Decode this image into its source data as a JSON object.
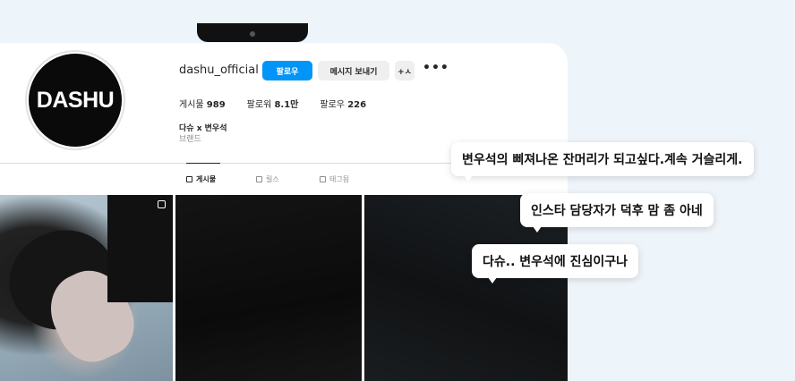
{
  "profile": {
    "avatar_text": "DASHU",
    "username": "dashu_official",
    "follow_label": "팔로우",
    "message_label": "메시지 보내기",
    "add_user_icon": "+ㅅ",
    "more_icon": "•••",
    "stats": {
      "posts_label": "게시물",
      "posts_value": "989",
      "followers_label": "팔로워",
      "followers_value": "8.1만",
      "following_label": "팔로우",
      "following_value": "226"
    },
    "full_name": "다슈 x 변우석",
    "category": "브랜드"
  },
  "tabs": [
    {
      "label": "게시물",
      "icon": "grid-icon",
      "active": true
    },
    {
      "label": "릴스",
      "icon": "reels-icon",
      "active": false
    },
    {
      "label": "태그됨",
      "icon": "tag-icon",
      "active": false
    }
  ],
  "comments": [
    "변우석의 삐져나온 잔머리가 되고싶다.계속 거슬리게.",
    "인스타 담당자가 덕후 맘 좀 아네",
    "다슈.. 변우석에 진심이구나"
  ],
  "colors": {
    "accent": "#0095f6",
    "background": "#eef5fa",
    "button_gray": "#efefef"
  }
}
